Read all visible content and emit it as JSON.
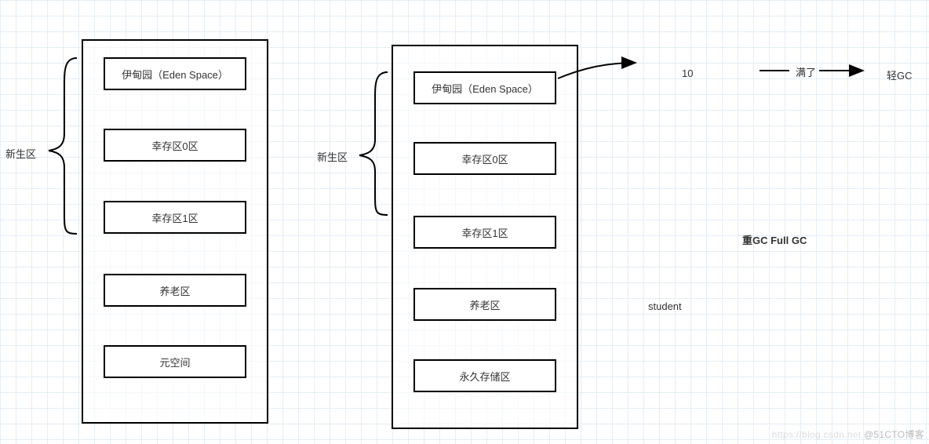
{
  "cluster1": {
    "section_label": "新生区",
    "boxes": {
      "eden": "伊甸园（Eden Space）",
      "survivor0": "幸存区0区",
      "survivor1": "幸存区1区",
      "old": "养老区",
      "meta": "元空间"
    }
  },
  "cluster2": {
    "section_label": "新生区",
    "boxes": {
      "eden": "伊甸园（Eden Space）",
      "survivor0": "幸存区0区",
      "survivor1": "幸存区1区",
      "old": "养老区",
      "perm": "永久存储区"
    }
  },
  "annotations": {
    "count": "10",
    "full_label": "满了",
    "light_gc": "轻GC",
    "heavy_gc": "重GC  Full GC",
    "student": "student"
  },
  "watermark": {
    "left": "https://blog.csdn.net",
    "right": "@51CTO博客"
  }
}
